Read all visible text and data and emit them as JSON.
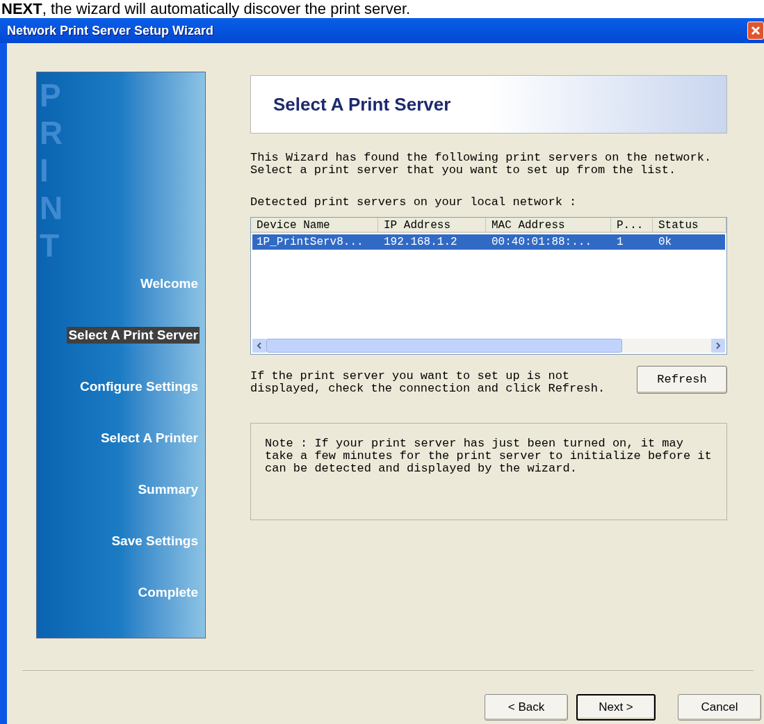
{
  "caption": "**NEXT**, the wizard will automatically discover the print server.",
  "window": {
    "title": "Network Print Server Setup Wizard"
  },
  "sidebar": {
    "watermark": "PRINT",
    "steps": [
      {
        "label": "Welcome",
        "selected": false
      },
      {
        "label": "Select A Print Server",
        "selected": true
      },
      {
        "label": "Configure Settings",
        "selected": false
      },
      {
        "label": "Select A Printer",
        "selected": false
      },
      {
        "label": "Summary",
        "selected": false
      },
      {
        "label": "Save Settings",
        "selected": false
      },
      {
        "label": "Complete",
        "selected": false
      }
    ]
  },
  "header": {
    "title": "Select A Print Server"
  },
  "intro": [
    "This Wizard has found the following print servers on the network.",
    "Select a print server that you want to set up from the list."
  ],
  "list_label": "Detected print servers on your local network :",
  "table": {
    "columns": [
      "Device Name",
      "IP Address",
      "MAC Address",
      "P...",
      "Status"
    ],
    "rows": [
      {
        "cells": [
          "1P_PrintServ8...",
          "192.168.1.2",
          "00:40:01:88:...",
          "1",
          "0k"
        ],
        "selected": true
      }
    ]
  },
  "refresh_hint": "If the print server you want to set up is not displayed, check the connection and click Refresh.",
  "refresh_button": "Refresh",
  "note": "Note : If your print server has just been turned on, it may take a few minutes for the print server to initialize before it can be detected and displayed by the wizard.",
  "buttons": [
    {
      "label": "< Back",
      "kind": "normal"
    },
    {
      "label": "Next >",
      "kind": "default"
    },
    {
      "label": "Cancel",
      "kind": "normal"
    }
  ]
}
